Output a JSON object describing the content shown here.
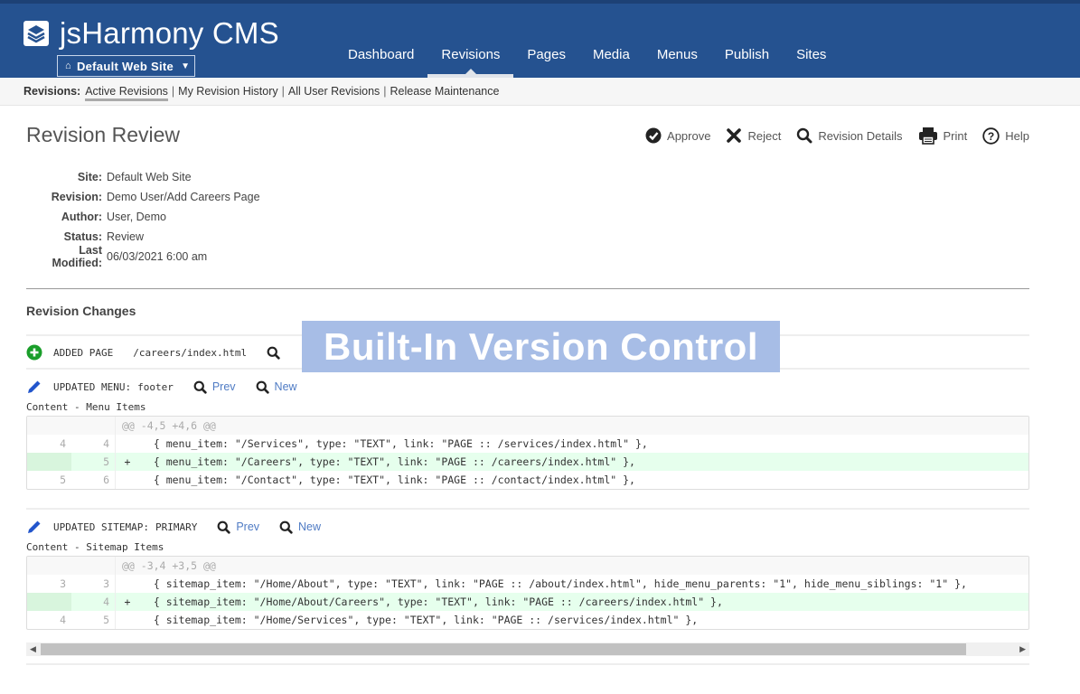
{
  "header": {
    "app_title": "jsHarmony CMS",
    "site_selector": "Default Web Site",
    "nav": [
      {
        "label": "Dashboard",
        "active": false
      },
      {
        "label": "Revisions",
        "active": true
      },
      {
        "label": "Pages",
        "active": false
      },
      {
        "label": "Media",
        "active": false
      },
      {
        "label": "Menus",
        "active": false
      },
      {
        "label": "Publish",
        "active": false
      },
      {
        "label": "Sites",
        "active": false
      }
    ]
  },
  "subnav": {
    "label": "Revisions:",
    "links": [
      "Active Revisions",
      "My Revision History",
      "All User Revisions",
      "Release Maintenance"
    ],
    "separator": "|"
  },
  "page": {
    "title": "Revision Review",
    "actions": {
      "approve": "Approve",
      "reject": "Reject",
      "details": "Revision Details",
      "print": "Print",
      "help": "Help"
    }
  },
  "info": [
    {
      "key": "Site:",
      "value": "Default Web Site"
    },
    {
      "key": "Revision:",
      "value": "Demo User/Add Careers Page"
    },
    {
      "key": "Author:",
      "value": "User, Demo"
    },
    {
      "key": "Status:",
      "value": "Review"
    },
    {
      "key": "Last Modified:",
      "value": "06/03/2021 6:00 am"
    }
  ],
  "changes": {
    "title": "Revision Changes",
    "added_page": {
      "label": "ADDED PAGE",
      "path": "/careers/index.html"
    },
    "menu": {
      "label": "UPDATED MENU:",
      "name": "footer",
      "prev": "Prev",
      "new": "New",
      "content_label": "Content - Menu Items",
      "hunk": "@@ -4,5 +4,6 @@",
      "lines": [
        {
          "old": "4",
          "new": "4",
          "marker": "",
          "code": "  { menu_item: \"/Services\", type: \"TEXT\", link: \"PAGE :: /services/index.html\" },",
          "added": false
        },
        {
          "old": "",
          "new": "5",
          "marker": "+",
          "code": "  { menu_item: \"/Careers\", type: \"TEXT\", link: \"PAGE :: /careers/index.html\" },",
          "added": true
        },
        {
          "old": "5",
          "new": "6",
          "marker": "",
          "code": "  { menu_item: \"/Contact\", type: \"TEXT\", link: \"PAGE :: /contact/index.html\" },",
          "added": false
        }
      ]
    },
    "sitemap": {
      "label": "UPDATED SITEMAP:",
      "name": "PRIMARY",
      "prev": "Prev",
      "new": "New",
      "content_label": "Content - Sitemap Items",
      "hunk": "@@ -3,4 +3,5 @@",
      "lines": [
        {
          "old": "3",
          "new": "3",
          "marker": "",
          "code": "  { sitemap_item: \"/Home/About\", type: \"TEXT\", link: \"PAGE :: /about/index.html\", hide_menu_parents: \"1\", hide_menu_siblings: \"1\" },",
          "added": false
        },
        {
          "old": "",
          "new": "4",
          "marker": "+",
          "code": "  { sitemap_item: \"/Home/About/Careers\", type: \"TEXT\", link: \"PAGE :: /careers/index.html\" },",
          "added": true
        },
        {
          "old": "4",
          "new": "5",
          "marker": "",
          "code": "  { sitemap_item: \"/Home/Services\", type: \"TEXT\", link: \"PAGE :: /services/index.html\" },",
          "added": false
        }
      ]
    }
  },
  "overlay_banner": "Built-In Version Control",
  "colors": {
    "header_bg": "#255290",
    "link": "#4f7bc4",
    "added_bg": "#e6ffed",
    "add_icon": "#1a9e2a",
    "edit_icon": "#2255cc",
    "overlay_bg": "#a7bde6"
  }
}
